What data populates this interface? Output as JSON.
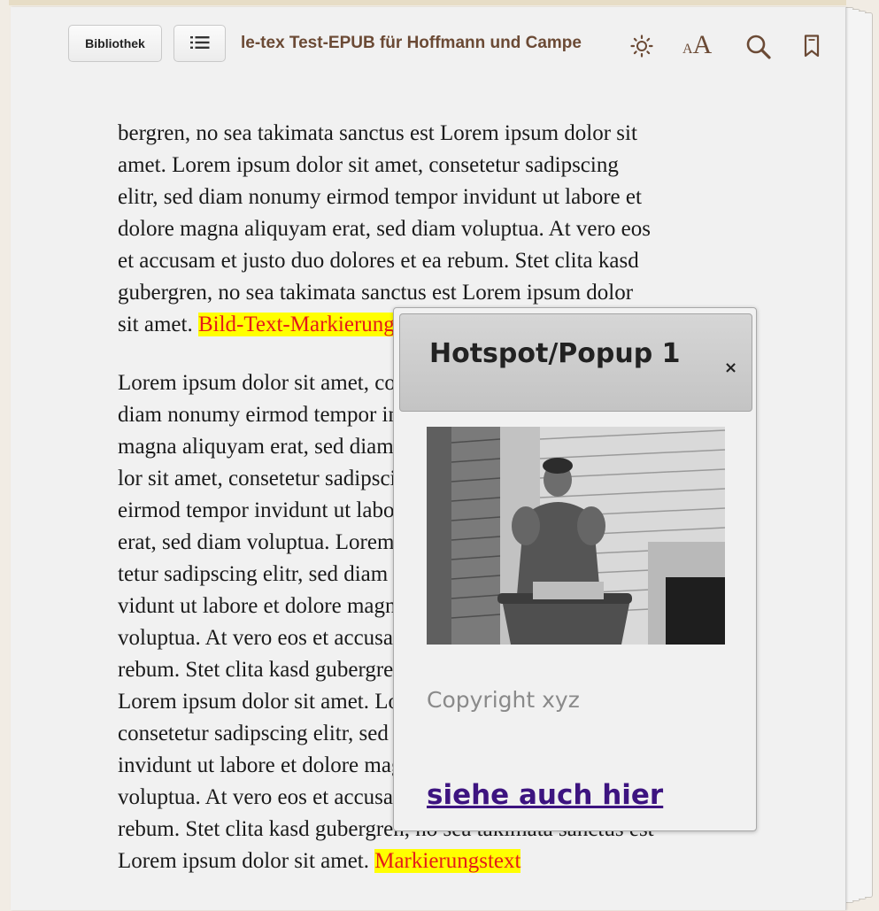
{
  "toolbar": {
    "library_label": "Bibliothek",
    "book_title": "le-tex Test-EPUB für Hoffmann und Campe",
    "font_small": "A",
    "font_large": "A",
    "icons": [
      "list-icon",
      "brightness-icon",
      "font-size-icon",
      "search-icon",
      "bookmark-icon"
    ]
  },
  "content": {
    "para1_lines": [
      "bergren, no sea takimata sanctus est Lorem ipsum dolor sit",
      "amet. Lorem ipsum dolor sit amet, consetetur sadipscing",
      "elitr, sed diam nonumy eirmod tempor invidunt ut labore et",
      "dolore magna aliquyam erat, sed diam voluptua. At vero eos",
      "et accusam et justo duo dolores et ea rebum. Stet clita kasd",
      "gubergren, no sea takimata sanctus est Lorem ipsum dolor"
    ],
    "para1_last_prefix": "sit amet. ",
    "para1_marker": "Bild-Text-Markierung",
    "para2_lines": [
      "Lorem ipsum dolor sit amet, consetetur sadipscing elitr, sed",
      "diam nonumy eirmod tempor invidunt ut labore et dolore",
      "magna aliquyam erat, sed diam voluptua. At vero eos et ac-",
      "lor sit amet, consetetur sadipscing elitr, sed diam nonumy",
      "eirmod tempor invidunt ut labore et dolore magna aliquyam",
      "erat, sed diam voluptua. Lorem ipsum dolor sit amet, conse-",
      "tetur sadipscing elitr, sed diam nonumy eirmod tempor in-",
      "vidunt ut labore et dolore magna aliquyam erat, sed diam",
      "voluptua. At vero eos et accusam et justo duo dolores et ea",
      "rebum. Stet clita kasd gubergren, no sea takimata sanctus est",
      "Lorem ipsum dolor sit amet. Lorem ipsum dolor sit amet,",
      "consetetur sadipscing elitr, sed diam nonumy eirmod tempor",
      "invidunt ut labore et dolore magna aliquyam erat, sed diam",
      "voluptua. At vero eos et accusam et justo duo dolores et ea",
      "rebum. Stet clita kasd gubergren, no sea takimata sanctus est"
    ],
    "para2_last_prefix": "Lorem ipsum dolor sit amet. ",
    "para2_marker": "Markierungstext"
  },
  "popup": {
    "title": "Hotspot/Popup 1",
    "close_symbol": "×",
    "caption": "Copyright xyz",
    "link_text": "siehe auch hier"
  },
  "colors": {
    "title_brown": "#6b4a35",
    "highlight_bg": "#ffff00",
    "highlight_text": "#e51a1a",
    "link": "#3d1480"
  }
}
